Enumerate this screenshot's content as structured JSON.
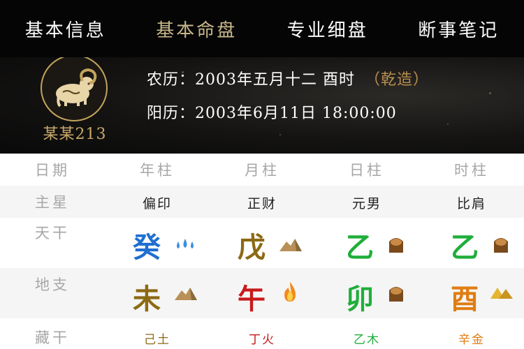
{
  "nav": {
    "items": [
      "基本信息",
      "基本命盘",
      "专业细盘",
      "断事笔记"
    ],
    "active_index": 1
  },
  "profile": {
    "name": "某某213",
    "avatar_icon": "ram-zodiac-icon",
    "lunar_label": "农历：",
    "lunar_value": "2003年五月十二 酉时",
    "gender_tag": "（乾造）",
    "solar_label": "阳历：",
    "solar_value": "2003年6月11日 18:00:00"
  },
  "table": {
    "row_labels": [
      "日期",
      "主星",
      "天干",
      "地支",
      "藏干"
    ],
    "columns": [
      "年柱",
      "月柱",
      "日柱",
      "时柱"
    ],
    "main_stars": [
      "偏印",
      "正财",
      "元男",
      "比肩"
    ],
    "tiangan": [
      {
        "char": "癸",
        "color": "#1f6fd1",
        "icon": "water-drops-icon"
      },
      {
        "char": "戊",
        "color": "#8c6a14",
        "icon": "earth-mound-icon"
      },
      {
        "char": "乙",
        "color": "#1fae3a",
        "icon": "wood-log-icon"
      },
      {
        "char": "乙",
        "color": "#1fae3a",
        "icon": "wood-log-icon"
      }
    ],
    "dizhi": [
      {
        "char": "未",
        "color": "#8c6a14",
        "icon": "earth-mound-icon"
      },
      {
        "char": "午",
        "color": "#c8191b",
        "icon": "fire-flame-icon"
      },
      {
        "char": "卯",
        "color": "#1fae3a",
        "icon": "wood-log-icon"
      },
      {
        "char": "酉",
        "color": "#e07d12",
        "icon": "gold-ingot-icon"
      }
    ],
    "canggan": [
      {
        "text": "己土",
        "color": "#8c6a14"
      },
      {
        "text": "丁火",
        "color": "#c8191b"
      },
      {
        "text": "乙木",
        "color": "#1fae3a"
      },
      {
        "text": "辛金",
        "color": "#e07d12"
      }
    ]
  }
}
